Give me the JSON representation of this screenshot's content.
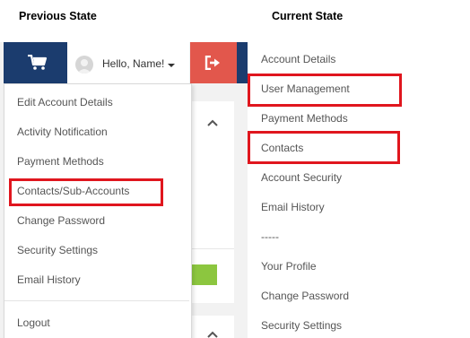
{
  "headings": {
    "previous": "Previous State",
    "current": "Current State"
  },
  "previous_state": {
    "topbar": {
      "cart_icon": "shopping-cart-icon",
      "user_greeting": "Hello, Name!",
      "avatar_icon": "user-avatar-icon",
      "caret_icon": "chevron-down-icon",
      "signout_icon": "sign-out-icon",
      "colors": {
        "navy": "#1b3c6e",
        "red": "#e2574c"
      }
    },
    "dropdown_items": [
      "Edit Account Details",
      "Activity Notification",
      "Payment Methods",
      "Contacts/Sub-Accounts",
      "Change Password",
      "Security Settings",
      "Email History"
    ],
    "logout_label": "Logout",
    "highlighted_item": "Contacts/Sub-Accounts",
    "green_button_color": "#8cc63f"
  },
  "current_state": {
    "menu_items": [
      "Account Details",
      "User Management",
      "Payment Methods",
      "Contacts",
      "Account Security",
      "Email History",
      "-----",
      "Your Profile",
      "Change Password",
      "Security Settings"
    ],
    "highlighted_items": [
      "User Management",
      "Contacts"
    ]
  },
  "highlight_color": "#e0161e"
}
